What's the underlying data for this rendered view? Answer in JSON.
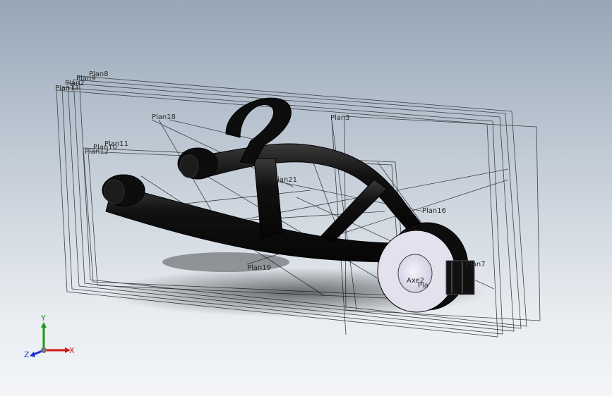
{
  "viewport": {
    "background_top": "#97a7b8",
    "background_bottom": "#f3f5f7",
    "part_color": "#0d0d0d"
  },
  "planes": [
    "Plan8",
    "Plan9",
    "Plan2",
    "Plan13",
    "Plan18",
    "Plan3",
    "Plan11",
    "Plan10",
    "Plan12",
    "Plan21",
    "Plan16",
    "Plan19",
    "Plan7",
    "Pla"
  ],
  "axis_feature": "Axe2",
  "triad": {
    "x": "X",
    "y": "Y",
    "z": "Z"
  }
}
